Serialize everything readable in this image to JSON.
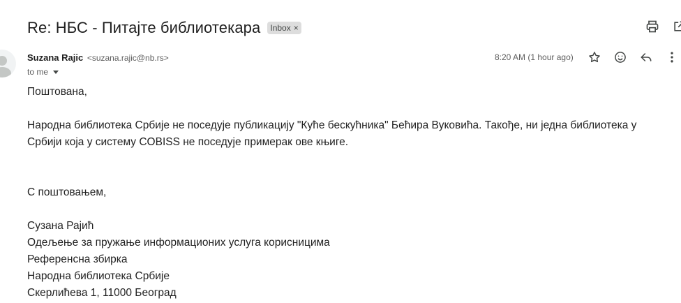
{
  "email": {
    "subject": "Re: НБС - Питајте библиотекара",
    "label": "Inbox",
    "label_remove": "×",
    "sender_name": "Suzana Rajic",
    "sender_email": "<suzana.rajic@nb.rs>",
    "recipient": "to me",
    "timestamp": "8:20 AM (1 hour ago)",
    "body": {
      "greeting": "Поштована,",
      "line1": "Народна библиотека Србије не поседује публикацију \"Куће бескућника\" Бећира Вуковића. Такође, ни једна библиотека у",
      "line2": "Србији која у систему COBISS не поседује примерак ове књиге.",
      "closing": "С поштовањем,",
      "sig_name": "Сузана Рајић",
      "sig_dept": "Одељење за пружање информационих услуга корисницима",
      "sig_unit": "Референсна збирка",
      "sig_org": "Народна библиотека Србије",
      "sig_address": "Скерлићева 1, 11000 Београд"
    }
  },
  "icons": {
    "print": "printer-icon",
    "open_new": "open-in-new-window-icon",
    "star": "star-icon",
    "emoji": "emoji-reaction-icon",
    "reply": "reply-icon",
    "more": "more-vertical-icon",
    "avatar": "person-avatar-icon"
  },
  "colors": {
    "text": "#1f1f1f",
    "muted": "#5e5e5e",
    "chip_bg": "#dddddd",
    "icon": "#444746"
  }
}
